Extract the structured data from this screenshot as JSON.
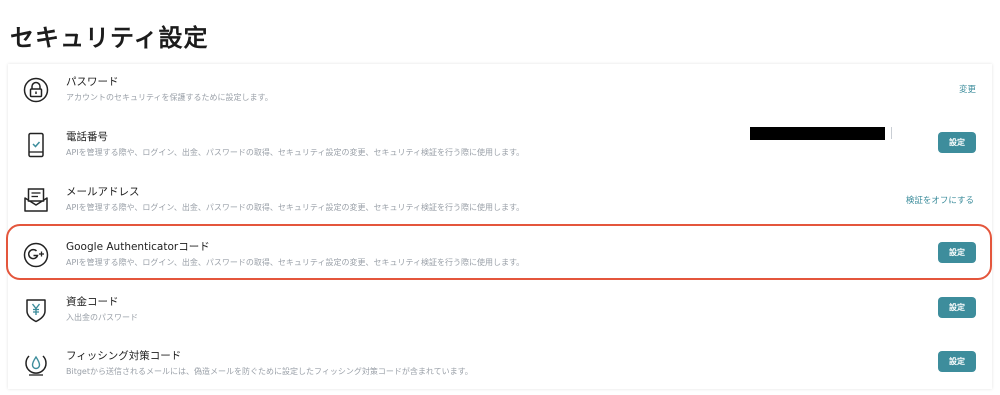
{
  "page_title": "セキュリティ設定",
  "rows": [
    {
      "title": "パスワード",
      "desc": "アカウントのセキュリティを保護するために設定します。",
      "icon": "lock-icon",
      "action": "変更"
    },
    {
      "title": "電話番号",
      "desc": "APIを管理する際や、ログイン、出金、パスワードの取得、セキュリティ設定の変更、セキュリティ検証を行う際に使用します。",
      "icon": "phone-icon",
      "action": "設定"
    },
    {
      "title": "メールアドレス",
      "desc": "APIを管理する際や、ログイン、出金、パスワードの取得、セキュリティ設定の変更、セキュリティ検証を行う際に使用します。",
      "icon": "mail-icon",
      "action": "検証をオフにする"
    },
    {
      "title": "Google Authenticatorコード",
      "desc": "APIを管理する際や、ログイン、出金、パスワードの取得、セキュリティ設定の変更、セキュリティ検証を行う際に使用します。",
      "icon": "google-authenticator-icon",
      "action": "設定"
    },
    {
      "title": "資金コード",
      "desc": "入出金のパスワード",
      "icon": "yen-shield-icon",
      "action": "設定"
    },
    {
      "title": "フィッシング対策コード",
      "desc": "Bitgetから送信されるメールには、偽造メールを防ぐために設定したフィッシング対策コードが含まれています。",
      "icon": "anti-phishing-icon",
      "action": "設定"
    }
  ],
  "colors": {
    "accent": "#3d8d9c",
    "highlight": "#e4563c"
  }
}
